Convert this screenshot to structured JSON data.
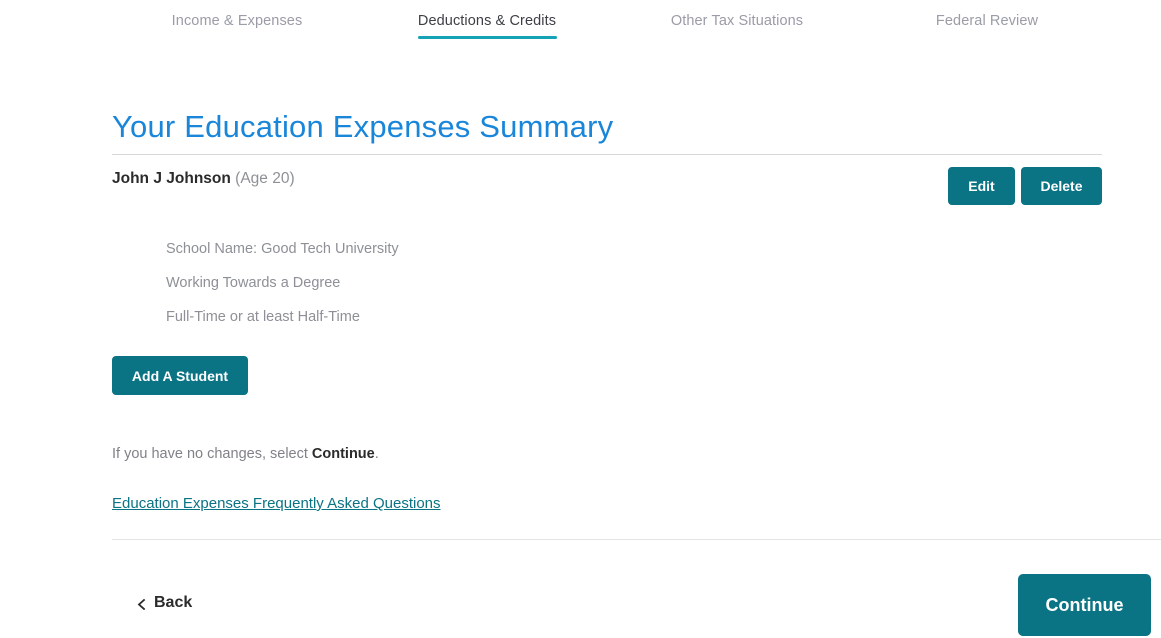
{
  "nav": {
    "tabs": [
      {
        "label": "Income & Expenses",
        "active": false
      },
      {
        "label": "Deductions & Credits",
        "active": true
      },
      {
        "label": "Other Tax Situations",
        "active": false
      },
      {
        "label": "Federal Review",
        "active": false
      }
    ]
  },
  "main": {
    "page_title": "Your Education Expenses Summary",
    "student": {
      "name": "John J Johnson",
      "age_text": "(Age 20)",
      "edit_label": "Edit",
      "delete_label": "Delete",
      "details": [
        "School Name: Good Tech University",
        "Working Towards a Degree",
        "Full-Time or at least Half-Time"
      ]
    },
    "add_student_label": "Add A Student",
    "hint": {
      "before": "If you have no changes, select ",
      "emphasis": "Continue",
      "after": "."
    },
    "faq_link_label": "Education Expenses Frequently Asked Questions"
  },
  "footer": {
    "back_label": "Back",
    "back_icon": "chevron-left-icon",
    "continue_label": "Continue"
  },
  "colors": {
    "accent_teal": "#0a7384",
    "tab_underline_teal": "#13a3b5",
    "title_blue": "#1a86d9",
    "muted_gray": "#8d9096",
    "divider_gray": "#d8d8d8"
  }
}
